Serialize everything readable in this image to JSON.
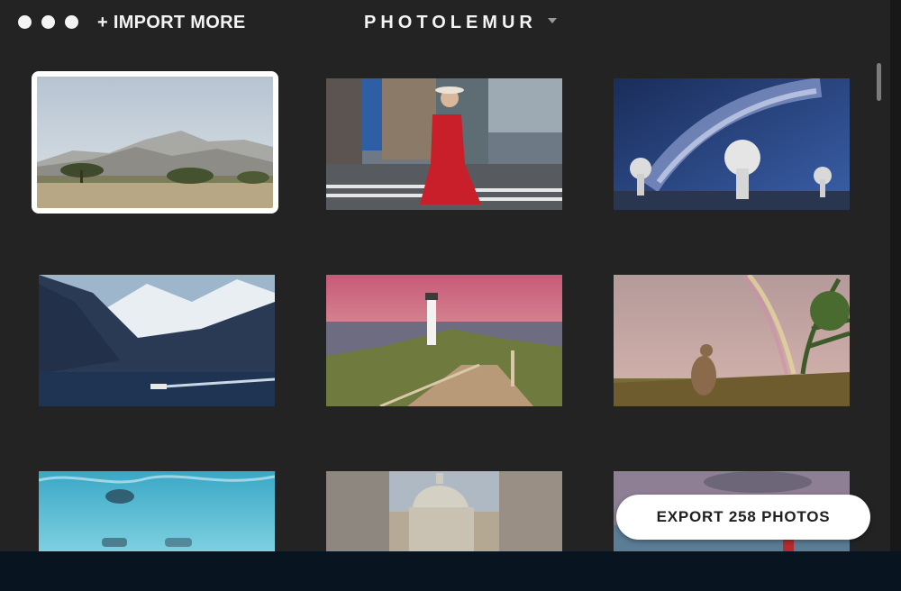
{
  "window": {
    "traffic_lights": [
      "close",
      "minimize",
      "zoom"
    ],
    "import_label": "+ IMPORT MORE",
    "app_title": "PHOTOLEMUR",
    "title_dropdown_icon": "chevron-down-icon"
  },
  "gallery": {
    "photos": [
      {
        "id": "mountains-savanna",
        "selected": true
      },
      {
        "id": "woman-red-dress"
      },
      {
        "id": "milky-way-telescopes"
      },
      {
        "id": "mountain-lake-boat"
      },
      {
        "id": "lighthouse-sunset"
      },
      {
        "id": "kangaroo-rainbow"
      },
      {
        "id": "underwater-swimmer"
      },
      {
        "id": "basilica-street"
      },
      {
        "id": "coast-clouds"
      }
    ]
  },
  "export": {
    "label": "EXPORT 258 PHOTOS"
  },
  "colors": {
    "window_bg": "#232323",
    "accent_button": "#ffffff",
    "desktop": "#081420"
  }
}
